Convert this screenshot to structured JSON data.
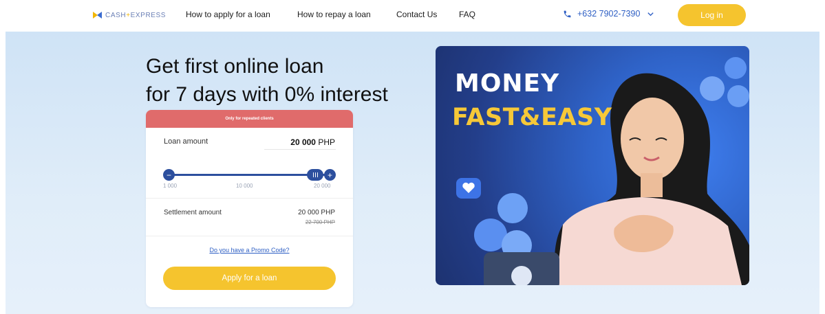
{
  "brand": {
    "logo_text_a": "CASH",
    "logo_sep": "+",
    "logo_text_b": "EXPRESS"
  },
  "nav": {
    "items": [
      {
        "label": "How to apply for a loan"
      },
      {
        "label": "How to repay a loan"
      },
      {
        "label": "Contact Us"
      },
      {
        "label": "FAQ"
      }
    ]
  },
  "header": {
    "phone": "+632 7902-7390",
    "login_label": "Log in"
  },
  "hero": {
    "headline_line1": "Get first online loan",
    "headline_line2": "for 7 days with 0% interest"
  },
  "calculator": {
    "banner": "Only for repeated clients",
    "loan_amount_label": "Loan amount",
    "loan_amount_value": "20 000",
    "currency": "PHP",
    "slider": {
      "min_label": "1 000",
      "mid_label": "10 000",
      "max_label": "20 000",
      "current_fraction": 1.0,
      "minus": "−",
      "plus": "+"
    },
    "settlement_label": "Settlement amount",
    "settlement_value": "20 000 PHP",
    "settlement_old": "22 700 PHP",
    "promo_link": "Do you have a Promo Code?",
    "apply_label": "Apply for a loan"
  },
  "banner_image": {
    "line1": "MONEY",
    "line2": "FAST&EASY"
  },
  "colors": {
    "accent_yellow": "#f5c42e",
    "brand_blue": "#2c4f9e",
    "link_blue": "#2e5fc4",
    "banner_red": "#e06b6b"
  }
}
